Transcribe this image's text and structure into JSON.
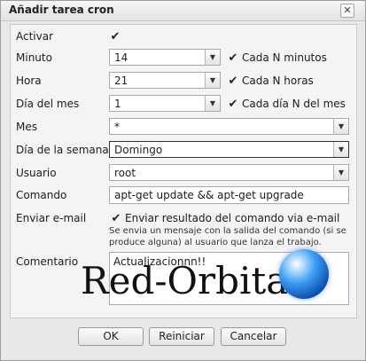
{
  "dialog": {
    "title": "Añadir tarea cron",
    "close_glyph": "✕"
  },
  "form": {
    "activar": {
      "label": "Activar",
      "checked": true
    },
    "minuto": {
      "label": "Minuto",
      "value": "14",
      "every_label": "Cada N minutos",
      "every_checked": true
    },
    "hora": {
      "label": "Hora",
      "value": "21",
      "every_label": "Cada N horas",
      "every_checked": true
    },
    "dia_mes": {
      "label": "Día del mes",
      "value": "1",
      "every_label": "Cada día N del mes",
      "every_checked": true
    },
    "mes": {
      "label": "Mes",
      "value": "*"
    },
    "dia_semana": {
      "label": "Día de la semana",
      "value": "Domingo"
    },
    "usuario": {
      "label": "Usuario",
      "value": "root"
    },
    "comando": {
      "label": "Comando",
      "value": "apt-get update && apt-get upgrade"
    },
    "email": {
      "label": "Enviar e-mail",
      "checkbox_label": "Enviar resultado del comando via e-mail",
      "checked": true,
      "note_line1": "Se envia un mensaje con la salida del comando (si se",
      "note_line2": "produce alguna) al usuario que lanza el trabajo."
    },
    "comentario": {
      "label": "Comentario",
      "value": "Actualizacionnn!!"
    }
  },
  "watermark": {
    "text": "Red-Orbita"
  },
  "buttons": {
    "ok": "OK",
    "reset": "Reiniciar",
    "cancel": "Cancelar"
  },
  "glyphs": {
    "check": "✔",
    "dropdown": "▼"
  }
}
